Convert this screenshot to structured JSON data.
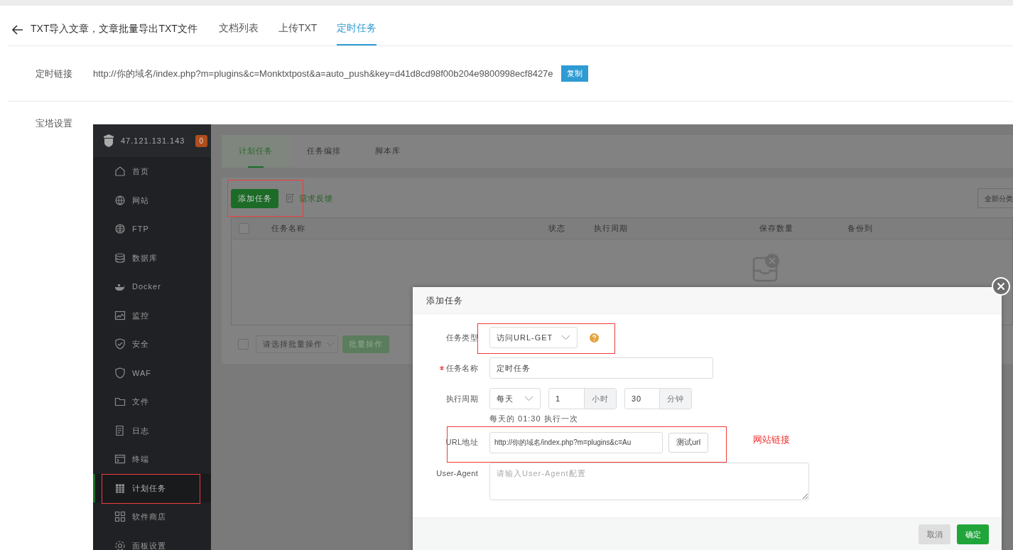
{
  "header": {
    "title": "TXT导入文章，文章批量导出TXT文件",
    "tabs": [
      {
        "label": "文档列表",
        "selected": false
      },
      {
        "label": "上传TXT",
        "selected": false
      },
      {
        "label": "定时任务",
        "selected": true
      }
    ]
  },
  "cron_link": {
    "label": "定时链接",
    "url": "http://你的域名/index.php?m=plugins&c=Monktxtpost&a=auto_push&key=d41d8cd98f00b204e9800998ecf8427e",
    "copy_button": "复制"
  },
  "bt_settings": {
    "label": "宝塔设置",
    "screenshot": {
      "server": "47.121.131.143",
      "alert_count": "0",
      "sidebar": [
        {
          "label": "首页",
          "selected": false
        },
        {
          "label": "网站",
          "selected": false
        },
        {
          "label": "FTP",
          "selected": false
        },
        {
          "label": "数据库",
          "selected": false
        },
        {
          "label": "Docker",
          "selected": false
        },
        {
          "label": "监控",
          "selected": false
        },
        {
          "label": "安全",
          "selected": false
        },
        {
          "label": "WAF",
          "selected": false
        },
        {
          "label": "文件",
          "selected": false
        },
        {
          "label": "日志",
          "selected": false
        },
        {
          "label": "终端",
          "selected": false
        },
        {
          "label": "计划任务",
          "selected": true,
          "highlighted": true
        },
        {
          "label": "软件商店",
          "selected": false
        },
        {
          "label": "面板设置",
          "selected": false
        }
      ],
      "tabs": [
        {
          "label": "计划任务",
          "selected": true
        },
        {
          "label": "任务编排",
          "selected": false
        },
        {
          "label": "脚本库",
          "selected": false
        }
      ],
      "add_button": {
        "label": "添加任务",
        "highlighted": true
      },
      "feedback": "需求反馈",
      "filter": "全部分类",
      "table": {
        "header_checkbox": {
          "checked": false
        },
        "columns": [
          "任务名称",
          "状态",
          "执行周期",
          "保存数量",
          "备份到"
        ]
      },
      "batch": {
        "checkbox": {
          "checked": false
        },
        "placeholder": "请选择批量操作",
        "button": {
          "label": "批量操作",
          "disabled": true
        }
      },
      "modal": {
        "title": "添加任务",
        "fields": [
          {
            "kind": "select",
            "label": "任务类型",
            "value": "访问URL-GET",
            "help": true,
            "highlighted": true
          },
          {
            "kind": "input",
            "label": "任务名称",
            "required": true,
            "value": "定时任务"
          },
          {
            "kind": "period",
            "label": "执行周期",
            "frequency": "每天",
            "hour": "1",
            "hour_unit": "小时",
            "minute": "30",
            "minute_unit": "分钟",
            "hint": "每天的 01:30 执行一次"
          },
          {
            "kind": "url",
            "label": "URL地址",
            "value": "http://你的域名/index.php?m=plugins&c=Au",
            "button": "测试url",
            "highlighted": true
          },
          {
            "kind": "textarea",
            "label": "User-Agent",
            "placeholder": "请输入User-Agent配置"
          }
        ],
        "buttons": [
          {
            "label": "取消",
            "kind": "cancel",
            "disabled": true
          },
          {
            "label": "确定",
            "kind": "confirm",
            "disabled": false
          }
        ]
      },
      "annotation": "网站链接"
    }
  }
}
